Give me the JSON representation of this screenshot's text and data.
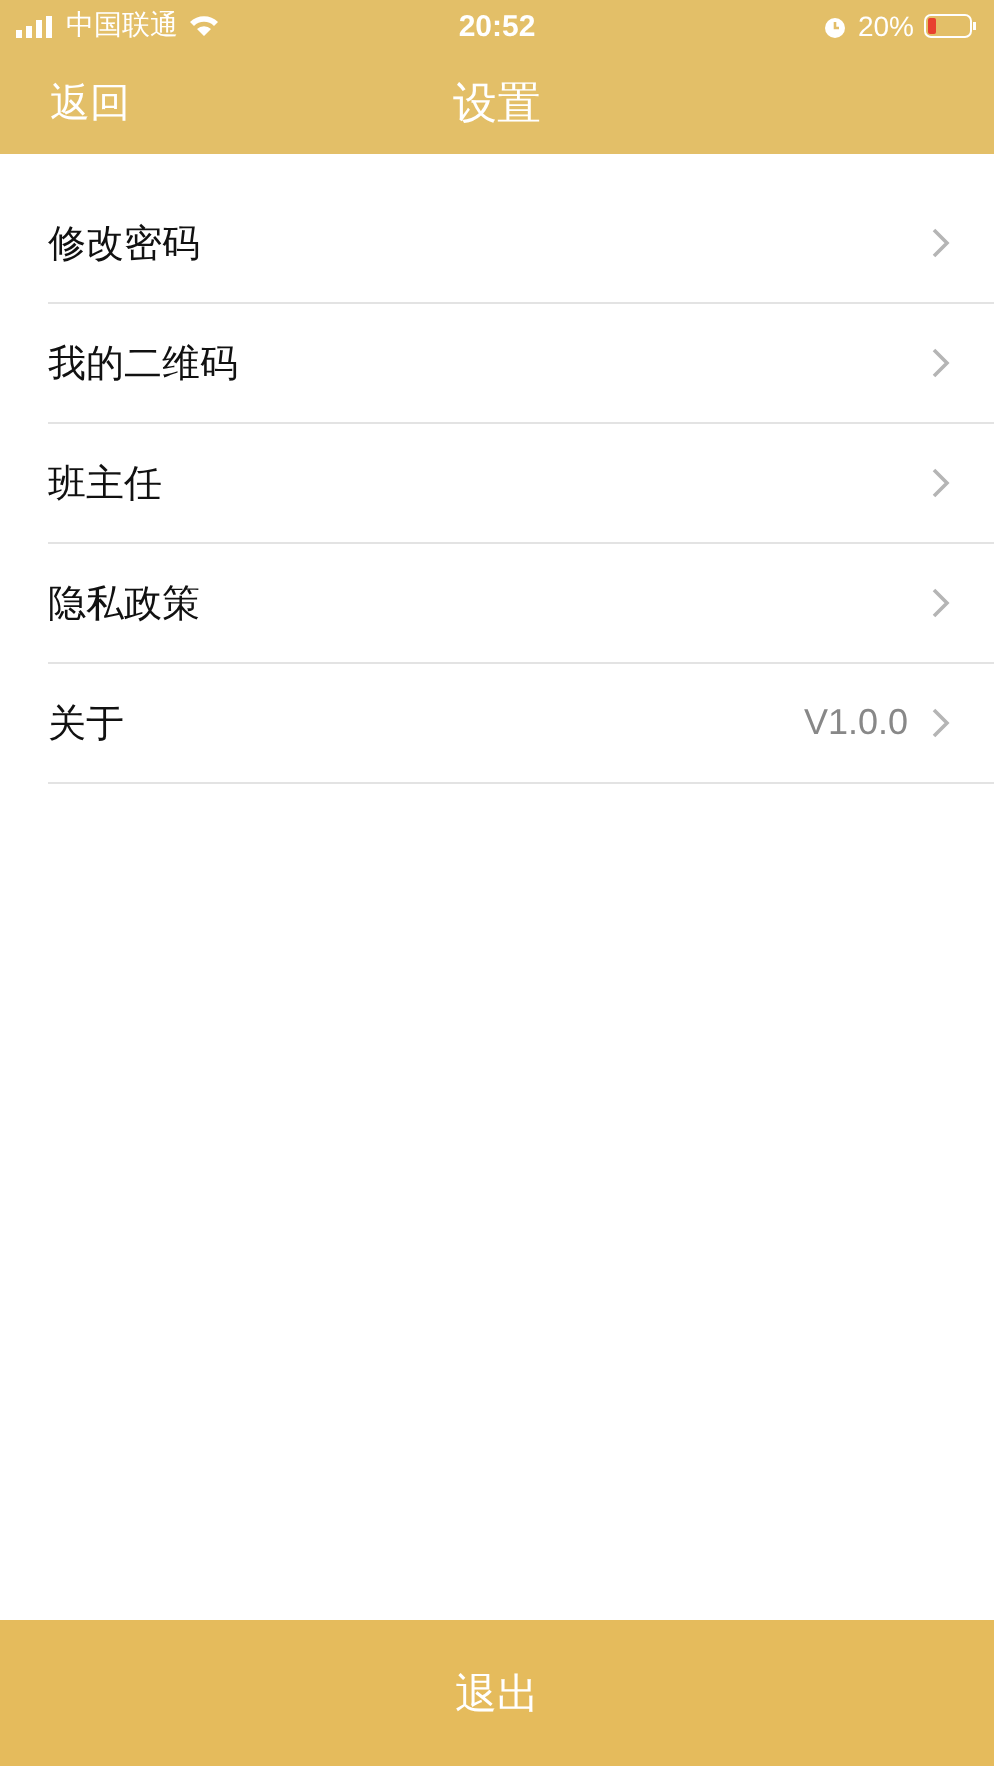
{
  "status_bar": {
    "carrier": "中国联通",
    "time": "20:52",
    "battery": "20%"
  },
  "nav_bar": {
    "back": "返回",
    "title": "设置"
  },
  "settings": [
    {
      "label": "修改密码"
    },
    {
      "label": "我的二维码"
    },
    {
      "label": "班主任"
    },
    {
      "label": "隐私政策"
    },
    {
      "label": "关于",
      "value": "V1.0.0"
    }
  ],
  "logout_button": "退出"
}
